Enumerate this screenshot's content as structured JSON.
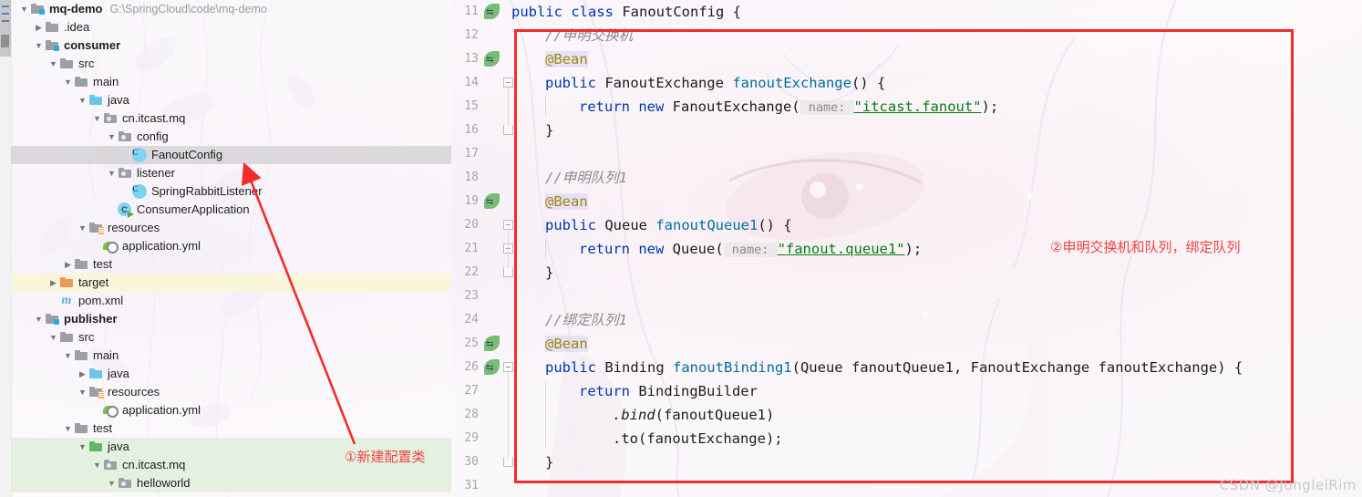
{
  "window": {
    "watermark": "CSDN @JungleiRim"
  },
  "project_tree": {
    "name": "project-tree",
    "rows": [
      {
        "indent": 0,
        "arrow": "v",
        "icon": "module-folder-icon",
        "label": "mq-demo",
        "bold": true,
        "path": "G:\\SpringCloud\\code\\mq-demo",
        "highlight": "none"
      },
      {
        "indent": 1,
        "arrow": ">",
        "icon": "folder-icon",
        "label": ".idea",
        "bold": false,
        "path": "",
        "highlight": "none"
      },
      {
        "indent": 1,
        "arrow": "v",
        "icon": "module-folder-icon",
        "label": "consumer",
        "bold": true,
        "path": "",
        "highlight": "none"
      },
      {
        "indent": 2,
        "arrow": "v",
        "icon": "folder-icon",
        "label": "src",
        "bold": false,
        "path": "",
        "highlight": "none"
      },
      {
        "indent": 3,
        "arrow": "v",
        "icon": "folder-icon",
        "label": "main",
        "bold": false,
        "path": "",
        "highlight": "none"
      },
      {
        "indent": 4,
        "arrow": "v",
        "icon": "source-folder-icon",
        "label": "java",
        "bold": false,
        "path": "",
        "highlight": "none"
      },
      {
        "indent": 5,
        "arrow": "v",
        "icon": "package-icon",
        "label": "cn.itcast.mq",
        "bold": false,
        "path": "",
        "highlight": "none"
      },
      {
        "indent": 6,
        "arrow": "v",
        "icon": "package-icon",
        "label": "config",
        "bold": false,
        "path": "",
        "highlight": "none"
      },
      {
        "indent": 7,
        "arrow": "",
        "icon": "java-class-icon",
        "label": "FanoutConfig",
        "bold": false,
        "path": "",
        "highlight": "selected"
      },
      {
        "indent": 6,
        "arrow": "v",
        "icon": "package-icon",
        "label": "listener",
        "bold": false,
        "path": "",
        "highlight": "none"
      },
      {
        "indent": 7,
        "arrow": "",
        "icon": "java-class-icon",
        "label": "SpringRabbitListener",
        "bold": false,
        "path": "",
        "highlight": "none"
      },
      {
        "indent": 6,
        "arrow": "",
        "icon": "java-runnable-class-icon",
        "label": "ConsumerApplication",
        "bold": false,
        "path": "",
        "highlight": "none"
      },
      {
        "indent": 4,
        "arrow": "v",
        "icon": "resources-folder-icon",
        "label": "resources",
        "bold": false,
        "path": "",
        "highlight": "none"
      },
      {
        "indent": 5,
        "arrow": "",
        "icon": "yaml-file-icon",
        "label": "application.yml",
        "bold": false,
        "path": "",
        "highlight": "none"
      },
      {
        "indent": 3,
        "arrow": ">",
        "icon": "folder-icon",
        "label": "test",
        "bold": false,
        "path": "",
        "highlight": "none"
      },
      {
        "indent": 2,
        "arrow": ">",
        "icon": "target-folder-icon",
        "label": "target",
        "bold": false,
        "path": "",
        "highlight": "yellow"
      },
      {
        "indent": 2,
        "arrow": "",
        "icon": "maven-pom-icon",
        "label": "pom.xml",
        "bold": false,
        "path": "",
        "highlight": "none"
      },
      {
        "indent": 1,
        "arrow": "v",
        "icon": "module-folder-icon",
        "label": "publisher",
        "bold": true,
        "path": "",
        "highlight": "none"
      },
      {
        "indent": 2,
        "arrow": "v",
        "icon": "folder-icon",
        "label": "src",
        "bold": false,
        "path": "",
        "highlight": "none"
      },
      {
        "indent": 3,
        "arrow": "v",
        "icon": "folder-icon",
        "label": "main",
        "bold": false,
        "path": "",
        "highlight": "none"
      },
      {
        "indent": 4,
        "arrow": ">",
        "icon": "source-folder-icon",
        "label": "java",
        "bold": false,
        "path": "",
        "highlight": "none"
      },
      {
        "indent": 4,
        "arrow": "v",
        "icon": "resources-folder-icon",
        "label": "resources",
        "bold": false,
        "path": "",
        "highlight": "none"
      },
      {
        "indent": 5,
        "arrow": "",
        "icon": "yaml-file-icon",
        "label": "application.yml",
        "bold": false,
        "path": "",
        "highlight": "none"
      },
      {
        "indent": 3,
        "arrow": "v",
        "icon": "folder-icon",
        "label": "test",
        "bold": false,
        "path": "",
        "highlight": "none"
      },
      {
        "indent": 4,
        "arrow": "v",
        "icon": "test-source-folder-icon",
        "label": "java",
        "bold": false,
        "path": "",
        "highlight": "green"
      },
      {
        "indent": 5,
        "arrow": "v",
        "icon": "package-icon",
        "label": "cn.itcast.mq",
        "bold": false,
        "path": "",
        "highlight": "green"
      },
      {
        "indent": 6,
        "arrow": "v",
        "icon": "package-icon",
        "label": "helloworld",
        "bold": false,
        "path": "",
        "highlight": "green"
      }
    ]
  },
  "editor": {
    "name": "code-editor",
    "line_numbers": [
      11,
      12,
      13,
      14,
      15,
      16,
      17,
      18,
      19,
      20,
      21,
      22,
      23,
      24,
      25,
      26,
      27,
      28,
      29,
      30,
      31
    ],
    "bean_gutter_lines": [
      11,
      13,
      19,
      25,
      26
    ],
    "lines": [
      {
        "n": 11,
        "indent": 0,
        "tokens": [
          {
            "t": "public ",
            "c": "kw"
          },
          {
            "t": "class ",
            "c": "kw"
          },
          {
            "t": "FanoutConfig {",
            "c": ""
          }
        ]
      },
      {
        "n": 12,
        "indent": 1,
        "tokens": [
          {
            "t": "//申明交换机",
            "c": "cmt"
          }
        ]
      },
      {
        "n": 13,
        "indent": 1,
        "tokens": [
          {
            "t": "@Bean",
            "c": "ann"
          }
        ]
      },
      {
        "n": 14,
        "indent": 1,
        "tokens": [
          {
            "t": "public ",
            "c": "kw"
          },
          {
            "t": "FanoutExchange ",
            "c": ""
          },
          {
            "t": "fanoutExchange",
            "c": "meth"
          },
          {
            "t": "() {",
            "c": ""
          }
        ]
      },
      {
        "n": 15,
        "indent": 2,
        "tokens": [
          {
            "t": "return ",
            "c": "kw"
          },
          {
            "t": "new ",
            "c": "kw"
          },
          {
            "t": "FanoutExchange(",
            "c": ""
          },
          {
            "t": " name: ",
            "c": "hint"
          },
          {
            "t": "\"itcast.fanout\"",
            "c": "str"
          },
          {
            "t": ");",
            "c": ""
          }
        ]
      },
      {
        "n": 16,
        "indent": 1,
        "tokens": [
          {
            "t": "}",
            "c": ""
          }
        ]
      },
      {
        "n": 17,
        "indent": 0,
        "tokens": []
      },
      {
        "n": 18,
        "indent": 1,
        "tokens": [
          {
            "t": "//申明队列1",
            "c": "cmt"
          }
        ]
      },
      {
        "n": 19,
        "indent": 1,
        "tokens": [
          {
            "t": "@Bean",
            "c": "ann"
          }
        ]
      },
      {
        "n": 20,
        "indent": 1,
        "tokens": [
          {
            "t": "public ",
            "c": "kw"
          },
          {
            "t": "Queue ",
            "c": ""
          },
          {
            "t": "fanoutQueue1",
            "c": "meth"
          },
          {
            "t": "() {",
            "c": ""
          }
        ]
      },
      {
        "n": 21,
        "indent": 2,
        "tokens": [
          {
            "t": "return ",
            "c": "kw"
          },
          {
            "t": "new ",
            "c": "kw"
          },
          {
            "t": "Queue(",
            "c": ""
          },
          {
            "t": " name: ",
            "c": "hint"
          },
          {
            "t": "\"fanout.queue1\"",
            "c": "str"
          },
          {
            "t": ");",
            "c": ""
          }
        ]
      },
      {
        "n": 22,
        "indent": 1,
        "tokens": [
          {
            "t": "}",
            "c": ""
          }
        ]
      },
      {
        "n": 23,
        "indent": 0,
        "tokens": []
      },
      {
        "n": 24,
        "indent": 1,
        "tokens": [
          {
            "t": "//绑定队列1",
            "c": "cmt"
          }
        ]
      },
      {
        "n": 25,
        "indent": 1,
        "tokens": [
          {
            "t": "@Bean",
            "c": "ann"
          }
        ]
      },
      {
        "n": 26,
        "indent": 1,
        "tokens": [
          {
            "t": "public ",
            "c": "kw"
          },
          {
            "t": "Binding ",
            "c": ""
          },
          {
            "t": "fanoutBinding1",
            "c": "meth"
          },
          {
            "t": "(Queue fanoutQueue1, FanoutExchange fanoutExchange) {",
            "c": ""
          }
        ]
      },
      {
        "n": 27,
        "indent": 2,
        "tokens": [
          {
            "t": "return ",
            "c": "kw"
          },
          {
            "t": "BindingBuilder",
            "c": ""
          }
        ]
      },
      {
        "n": 28,
        "indent": 3,
        "tokens": [
          {
            "t": ".bind",
            "c": "ital"
          },
          {
            "t": "(fanoutQueue1)",
            "c": ""
          }
        ]
      },
      {
        "n": 29,
        "indent": 3,
        "tokens": [
          {
            "t": ".to(fanoutExchange);",
            "c": ""
          }
        ]
      },
      {
        "n": 30,
        "indent": 1,
        "tokens": [
          {
            "t": "}",
            "c": ""
          }
        ]
      },
      {
        "n": 31,
        "indent": 0,
        "tokens": []
      }
    ]
  },
  "annotations": {
    "callout_1": "①新建配置类",
    "callout_2": "②申明交换机和队列，绑定队列",
    "box_color": "#f42b2b",
    "text_color": "#ef4444"
  }
}
